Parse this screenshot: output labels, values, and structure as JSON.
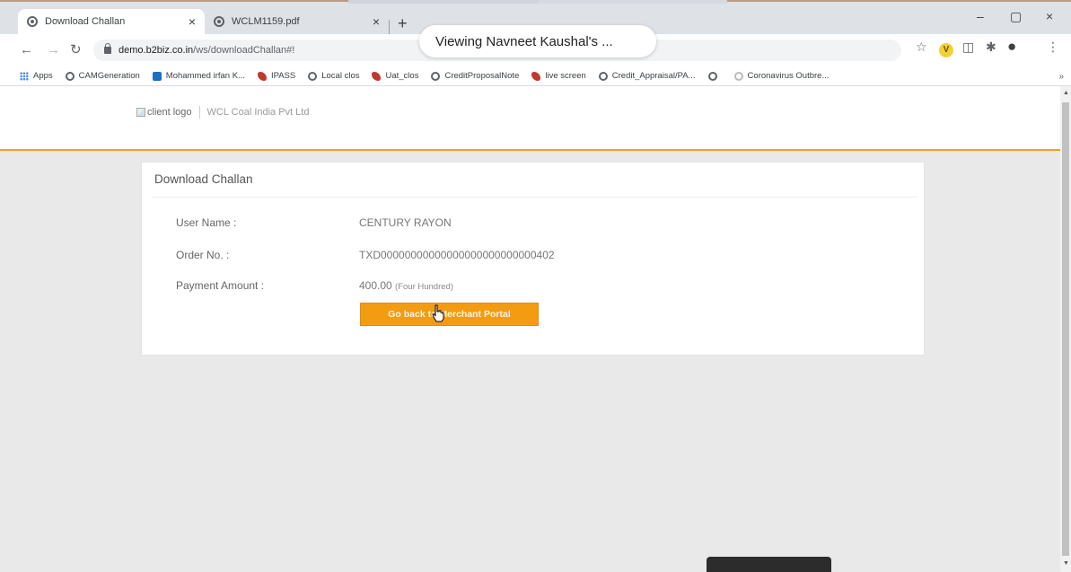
{
  "browser": {
    "tabs": [
      {
        "label": "Download Challan",
        "active": true
      },
      {
        "label": "WCLM1159.pdf",
        "active": false
      }
    ],
    "new_tab": "+",
    "share_popup": "Viewing Navneet Kaushal's ...",
    "url_host": "demo.b2biz.co.in",
    "url_path": "/ws/downloadChallan#!",
    "bookmarks": [
      {
        "label": "Apps",
        "icon": "apps-grid-icon"
      },
      {
        "label": "CAMGeneration",
        "icon": "globe-icon"
      },
      {
        "label": "Mohammed irfan K...",
        "icon": "outlook-icon"
      },
      {
        "label": "IPASS",
        "icon": "flame-icon"
      },
      {
        "label": "Local clos",
        "icon": "globe-icon"
      },
      {
        "label": "Uat_clos",
        "icon": "flame-icon"
      },
      {
        "label": "CreditProposalNote",
        "icon": "globe-icon"
      },
      {
        "label": "live screen",
        "icon": "flame-icon"
      },
      {
        "label": "Credit_Appraisal/PA...",
        "icon": "globe-icon"
      },
      {
        "label": "",
        "icon": "globe-icon"
      },
      {
        "label": "Coronavirus Outbre...",
        "icon": "info-icon"
      }
    ],
    "bookmarks_more": "»",
    "extension_badge": "V"
  },
  "page": {
    "logo_alt": "client logo",
    "company_name": "WCL Coal India Pvt Ltd",
    "card_title": "Download Challan",
    "fields": [
      {
        "label": "User Name :",
        "value": "CENTURY RAYON"
      },
      {
        "label": "Order No. :",
        "value": "TXD00000000000000000000000000402"
      },
      {
        "label": "Payment Amount :",
        "value": "400.00",
        "value_words": "(Four Hundred)"
      }
    ],
    "back_button": "Go back to Merchant Portal"
  },
  "colors": {
    "accent": "#f39c12",
    "header_border": "#f0a020"
  }
}
